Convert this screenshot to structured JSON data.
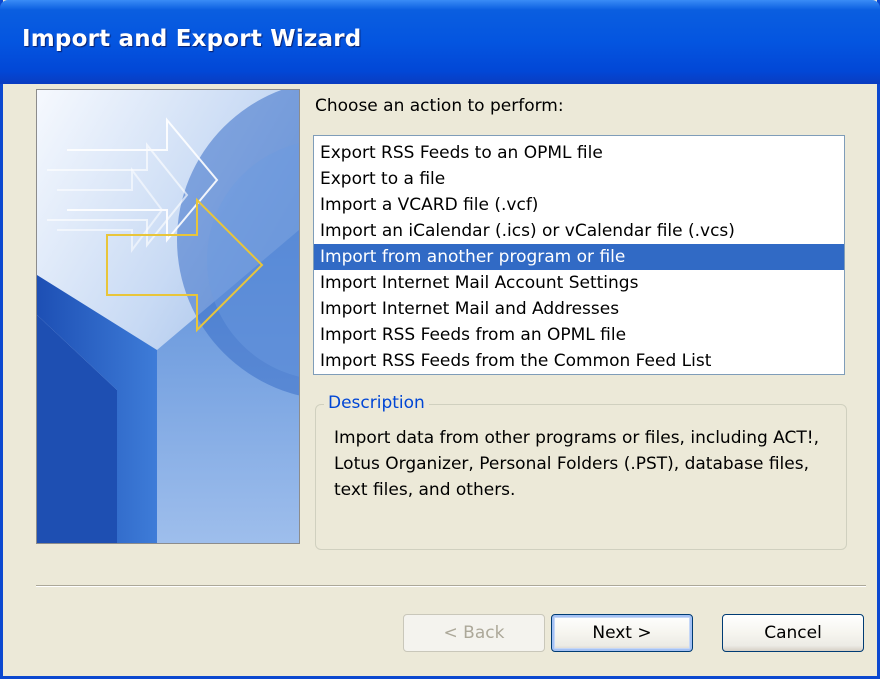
{
  "window": {
    "title": "Import and Export Wizard"
  },
  "prompt": "Choose an action to perform:",
  "actions": [
    {
      "label": "Export RSS Feeds to an OPML file",
      "selected": false
    },
    {
      "label": "Export to a file",
      "selected": false
    },
    {
      "label": "Import a VCARD file (.vcf)",
      "selected": false
    },
    {
      "label": "Import an iCalendar (.ics) or vCalendar file (.vcs)",
      "selected": false
    },
    {
      "label": "Import from another program or file",
      "selected": true
    },
    {
      "label": "Import Internet Mail Account Settings",
      "selected": false
    },
    {
      "label": "Import Internet Mail and Addresses",
      "selected": false
    },
    {
      "label": "Import RSS Feeds from an OPML file",
      "selected": false
    },
    {
      "label": "Import RSS Feeds from the Common Feed List",
      "selected": false
    }
  ],
  "description": {
    "label": "Description",
    "text": "Import data from other programs or files, including ACT!, Lotus Organizer, Personal Folders (.PST), database files, text files, and others."
  },
  "buttons": {
    "back": {
      "label": "< Back",
      "enabled": false
    },
    "next": {
      "label": "Next >",
      "enabled": true,
      "default": true
    },
    "cancel": {
      "label": "Cancel",
      "enabled": true
    }
  },
  "icons": {
    "banner": "wizard-arrows-graphic"
  },
  "colors": {
    "title_bar": "#0455E0",
    "selection": "#316AC5",
    "group_label": "#0046D5",
    "banner_arrow": "#E8C53A"
  }
}
